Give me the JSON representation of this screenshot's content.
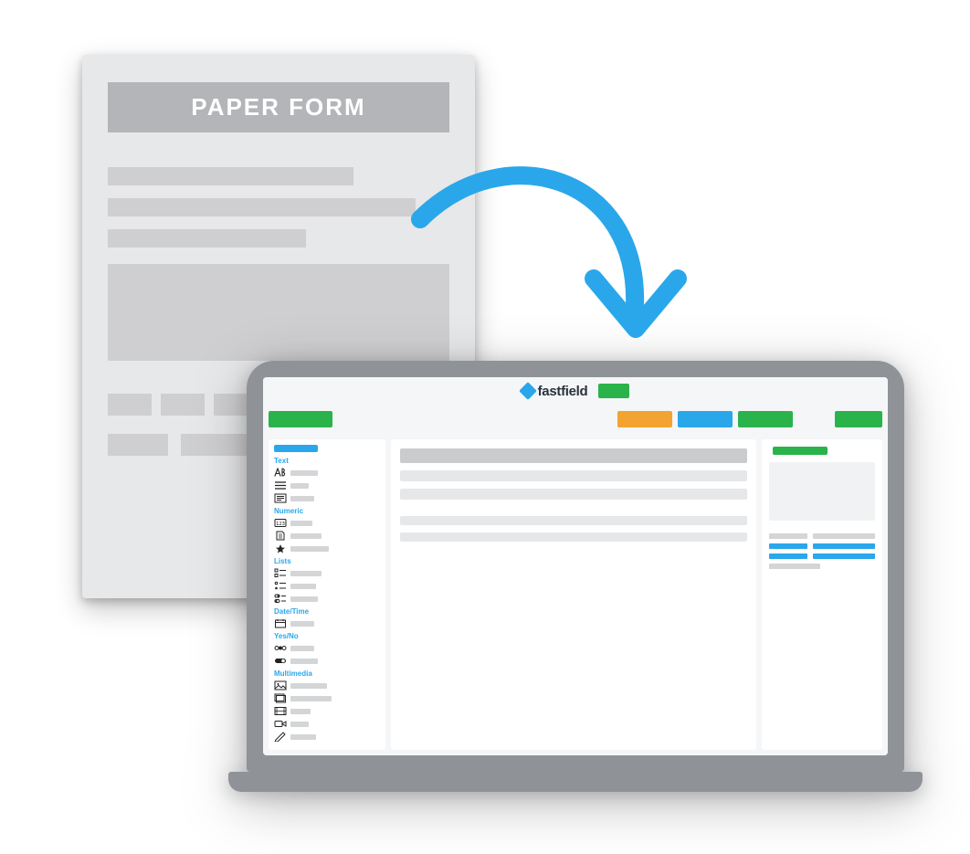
{
  "paper_form": {
    "title": "PAPER FORM"
  },
  "app": {
    "brand_name": "fastfield",
    "colors": {
      "primary_blue": "#2aa7ea",
      "green": "#2ab34a",
      "orange": "#f2a332"
    },
    "sidebar": {
      "categories": [
        {
          "label": "Text",
          "items": [
            {
              "icon": "text-icon"
            },
            {
              "icon": "lines-icon"
            },
            {
              "icon": "paragraph-icon"
            }
          ]
        },
        {
          "label": "Numeric",
          "items": [
            {
              "icon": "number-icon"
            },
            {
              "icon": "document-icon"
            },
            {
              "icon": "star-icon"
            }
          ]
        },
        {
          "label": "Lists",
          "items": [
            {
              "icon": "checklist-icon"
            },
            {
              "icon": "toggle-list-icon"
            },
            {
              "icon": "switch-list-icon"
            }
          ]
        },
        {
          "label": "Date/Time",
          "items": [
            {
              "icon": "calendar-icon"
            }
          ]
        },
        {
          "label": "Yes/No",
          "items": [
            {
              "icon": "radio-icon"
            },
            {
              "icon": "switch-icon"
            }
          ]
        },
        {
          "label": "Multimedia",
          "items": [
            {
              "icon": "image-icon"
            },
            {
              "icon": "gallery-icon"
            },
            {
              "icon": "film-icon"
            },
            {
              "icon": "video-icon"
            },
            {
              "icon": "pen-icon"
            }
          ]
        }
      ]
    }
  }
}
